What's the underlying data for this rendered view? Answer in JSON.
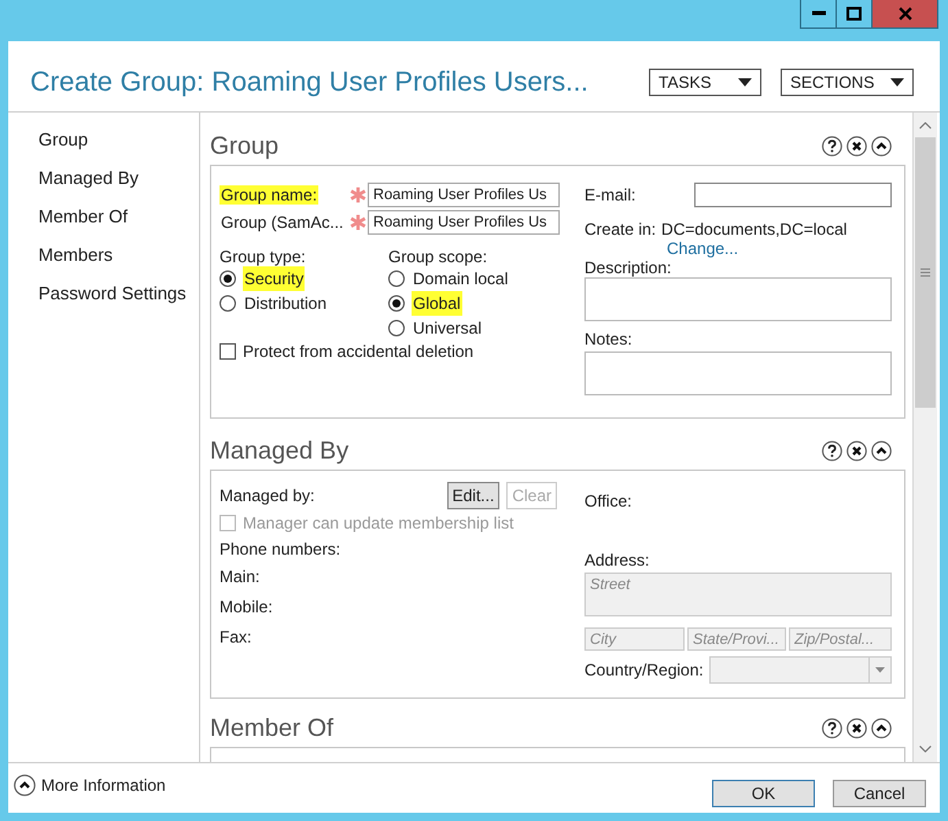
{
  "header": {
    "title": "Create Group: Roaming User Profiles Users...",
    "menus": [
      "TASKS",
      "SECTIONS"
    ]
  },
  "nav": [
    "Group",
    "Managed By",
    "Member Of",
    "Members",
    "Password Settings"
  ],
  "group_section": {
    "title": "Group",
    "fields": [
      {
        "label": "Group name:",
        "required": true,
        "value": "Roaming User Profiles Us",
        "highlighted": true
      },
      {
        "label": "Group (SamAc...",
        "required": true,
        "value": "Roaming User Profiles Us",
        "highlighted": false
      }
    ],
    "group_type": {
      "label": "Group type:",
      "options": [
        {
          "label": "Security",
          "selected": true,
          "highlighted": true
        },
        {
          "label": "Distribution",
          "selected": false,
          "highlighted": false
        }
      ]
    },
    "group_scope": {
      "label": "Group scope:",
      "options": [
        {
          "label": "Domain local",
          "selected": false,
          "highlighted": false
        },
        {
          "label": "Global",
          "selected": true,
          "highlighted": true
        },
        {
          "label": "Universal",
          "selected": false,
          "highlighted": false
        }
      ]
    },
    "protect": {
      "label": "Protect from accidental deletion",
      "checked": false
    },
    "email": {
      "label": "E-mail:"
    },
    "create_in": {
      "label": "Create in:",
      "value": "DC=documents,DC=local",
      "link": "Change..."
    },
    "description": {
      "label": "Description:"
    },
    "notes": {
      "label": "Notes:"
    }
  },
  "managed_by_section": {
    "title": "Managed By",
    "managed_by": {
      "label": "Managed by:",
      "buttons": [
        {
          "label": "Edit...",
          "disabled": false
        },
        {
          "label": "Clear",
          "disabled": true
        }
      ]
    },
    "manager_can_update": {
      "label": "Manager can update membership list",
      "checked": false,
      "disabled": true
    },
    "phone_label": "Phone numbers:",
    "phones": [
      "Main:",
      "Mobile:",
      "Fax:"
    ],
    "office": "Office:",
    "address": {
      "label": "Address:",
      "street": {
        "placeholder": "Street"
      },
      "city": {
        "placeholder": "City"
      },
      "state": {
        "placeholder": "State/Provi..."
      },
      "zip": {
        "placeholder": "Zip/Postal..."
      }
    },
    "country": {
      "label": "Country/Region:"
    }
  },
  "member_of_section": {
    "title": "Member Of"
  },
  "footer": {
    "more_info": "More Information",
    "buttons": [
      {
        "label": "OK",
        "default": true
      },
      {
        "label": "Cancel",
        "default": false
      }
    ]
  }
}
